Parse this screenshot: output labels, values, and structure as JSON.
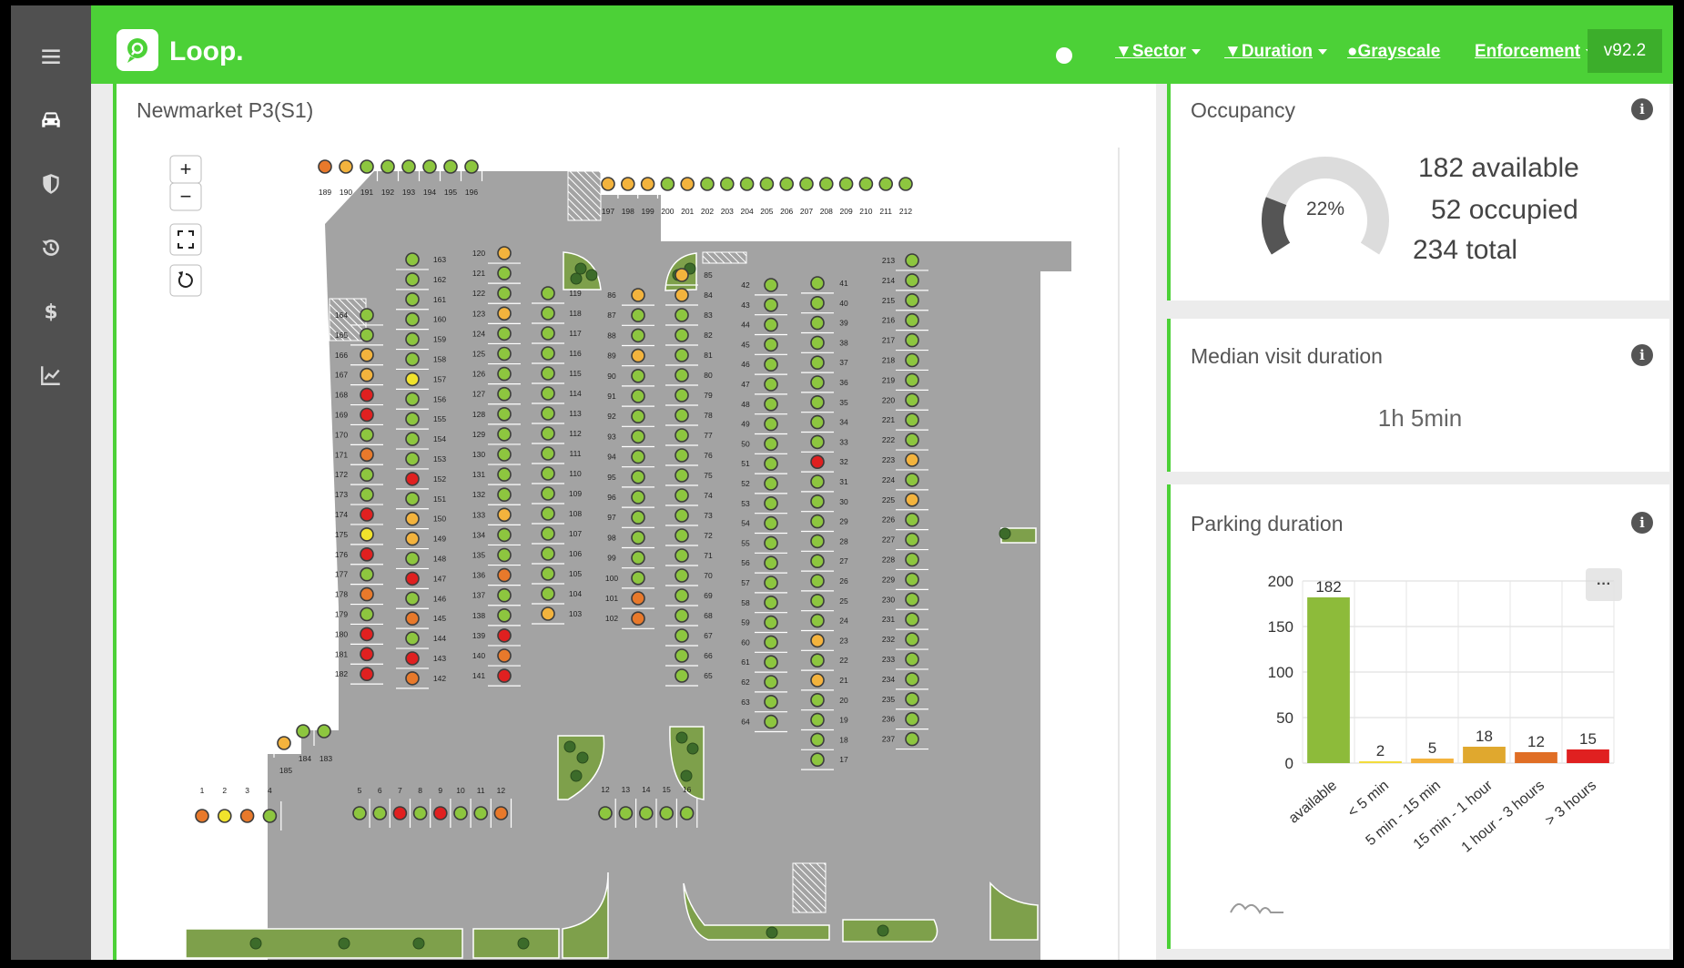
{
  "app": {
    "name": "Loop.",
    "version": "v92.2"
  },
  "topbar": {
    "filters": [
      {
        "label": "Sector"
      },
      {
        "label": "Duration"
      },
      {
        "label": "Grayscale"
      },
      {
        "label": "Enforcement"
      }
    ]
  },
  "sidebar": {
    "items": [
      {
        "icon": "menu-icon"
      },
      {
        "icon": "car-icon"
      },
      {
        "icon": "shield-icon"
      },
      {
        "icon": "history-icon"
      },
      {
        "icon": "dollar-icon"
      },
      {
        "icon": "chart-icon"
      }
    ]
  },
  "map": {
    "title": "Newmarket P3(S1)",
    "controls": {
      "zoom_in": "+",
      "zoom_out": "−"
    },
    "status_colors": {
      "free": "#8dc63f",
      "short": "#f0e32c",
      "medium": "#f3b33d",
      "long": "#e8792b",
      "very_long": "#e02020"
    },
    "spot_columns": [
      {
        "start": 189,
        "end": 196,
        "statuses": [
          "long",
          "medium",
          "free",
          "free",
          "free",
          "free",
          "free",
          "free"
        ]
      },
      {
        "start": 197,
        "end": 212,
        "statuses": [
          "medium",
          "medium",
          "medium",
          "free",
          "medium",
          "free",
          "free",
          "free",
          "free",
          "free",
          "free",
          "free",
          "free",
          "free",
          "free",
          "free"
        ]
      },
      {
        "start": 163,
        "end": 142,
        "statuses": [
          "free",
          "free",
          "free",
          "free",
          "free",
          "free",
          "short",
          "free",
          "free",
          "free",
          "free",
          "very_long",
          "free",
          "medium",
          "medium",
          "free",
          "very_long",
          "free",
          "long",
          "free",
          "very_long",
          "long"
        ]
      },
      {
        "start": 164,
        "end": 182,
        "statuses": [
          "free",
          "free",
          "medium",
          "medium",
          "very_long",
          "very_long",
          "free",
          "long",
          "free",
          "free",
          "very_long",
          "short",
          "very_long",
          "free",
          "long",
          "free",
          "very_long",
          "very_long",
          "very_long"
        ]
      },
      {
        "start": 120,
        "end": 141,
        "statuses": [
          "medium",
          "free",
          "free",
          "medium",
          "free",
          "free",
          "free",
          "free",
          "free",
          "free",
          "free",
          "free",
          "free",
          "medium",
          "free",
          "free",
          "long",
          "free",
          "free",
          "very_long",
          "long",
          "very_long"
        ]
      },
      {
        "start": 119,
        "end": 103,
        "statuses": [
          "free",
          "free",
          "free",
          "free",
          "free",
          "free",
          "free",
          "free",
          "free",
          "free",
          "free",
          "free",
          "free",
          "free",
          "free",
          "free",
          "medium"
        ]
      },
      {
        "start": 86,
        "end": 102,
        "statuses": [
          "medium",
          "free",
          "free",
          "medium",
          "free",
          "free",
          "free",
          "free",
          "free",
          "free",
          "free",
          "free",
          "free",
          "free",
          "free",
          "long",
          "long"
        ]
      },
      {
        "start": 85,
        "end": 65,
        "statuses": [
          "medium",
          "medium",
          "free",
          "free",
          "free",
          "free",
          "free",
          "free",
          "free",
          "free",
          "free",
          "free",
          "free",
          "free",
          "free",
          "free",
          "free",
          "free",
          "free",
          "free",
          "free"
        ]
      },
      {
        "start": 42,
        "end": 64,
        "statuses": [
          "free",
          "free",
          "free",
          "free",
          "free",
          "free",
          "free",
          "free",
          "free",
          "free",
          "free",
          "free",
          "free",
          "free",
          "free",
          "free",
          "free",
          "free",
          "free",
          "free",
          "free",
          "free",
          "free"
        ]
      },
      {
        "start": 41,
        "end": 17,
        "statuses": [
          "free",
          "free",
          "free",
          "free",
          "free",
          "free",
          "free",
          "free",
          "free",
          "very_long",
          "free",
          "free",
          "free",
          "free",
          "free",
          "free",
          "free",
          "free",
          "medium",
          "free",
          "medium",
          "free",
          "free",
          "free",
          "free"
        ]
      },
      {
        "start": 213,
        "end": 237,
        "statuses": [
          "free",
          "free",
          "free",
          "free",
          "free",
          "free",
          "free",
          "free",
          "free",
          "free",
          "medium",
          "free",
          "medium",
          "free",
          "free",
          "free",
          "free",
          "free",
          "free",
          "free",
          "free",
          "free",
          "free",
          "free",
          "free"
        ]
      },
      {
        "start": 1,
        "end": 4,
        "statuses": [
          "long",
          "short",
          "long",
          "free"
        ]
      },
      {
        "start": 5,
        "end": 11,
        "statuses": [
          "free",
          "free",
          "very_long",
          "free",
          "very_long",
          "free",
          "free",
          "long"
        ]
      },
      {
        "start": 12,
        "end": 16,
        "statuses": [
          "free",
          "free",
          "free",
          "free",
          "free"
        ]
      },
      {
        "start": 183,
        "end": 185,
        "statuses": [
          "free",
          "free",
          "medium"
        ]
      }
    ]
  },
  "occupancy": {
    "title": "Occupancy",
    "percent_label": "22%",
    "percent": 22,
    "available": "182 available",
    "occupied": "52 occupied",
    "total": "234 total"
  },
  "median": {
    "title": "Median visit duration",
    "value": "1h 5min"
  },
  "parking_duration": {
    "title": "Parking duration",
    "menu_label": "···"
  },
  "chart_data": {
    "type": "bar",
    "title": "Parking duration",
    "categories": [
      "available",
      "< 5 min",
      "5 min - 15 min",
      "15 min - 1 hour",
      "1 hour - 3 hours",
      "> 3 hours"
    ],
    "values": [
      182,
      2,
      5,
      18,
      12,
      15
    ],
    "colors": [
      "#8dbb3a",
      "#f2dc3c",
      "#f3b33d",
      "#e0a82e",
      "#e06e25",
      "#e02020"
    ],
    "ylim": [
      0,
      200
    ],
    "yticks": [
      0,
      50,
      100,
      150,
      200
    ],
    "grid": true,
    "legend": "none"
  }
}
